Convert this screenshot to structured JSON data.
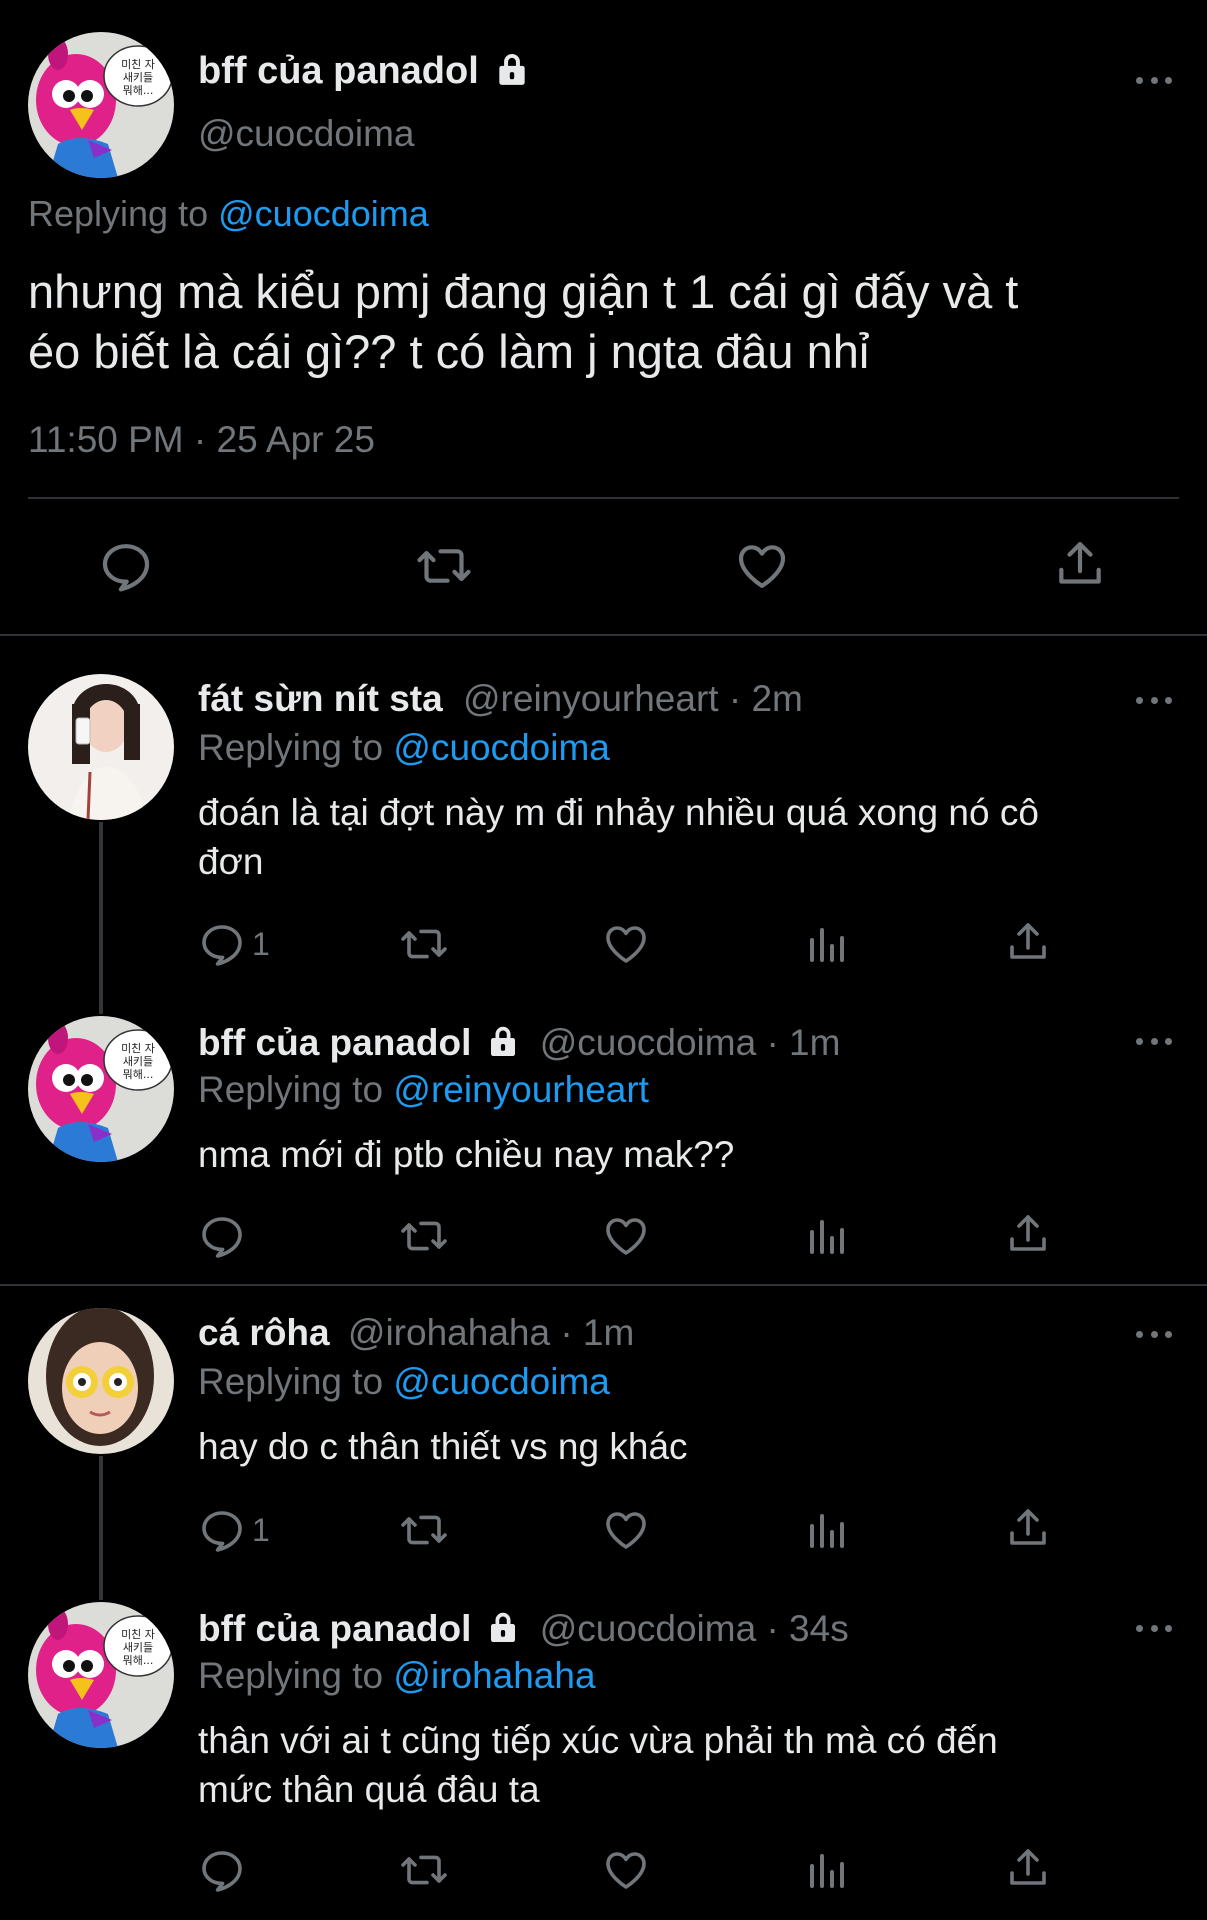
{
  "main_tweet": {
    "author_name": "bff của panadol",
    "author_handle": "@cuocdoima",
    "replying_prefix": "Replying to",
    "replying_to": "@cuocdoima",
    "text_line1": "nhưng mà kiểu pmj đang giận t 1 cái gì đấy và t",
    "text_line2": "éo biết là cái gì?? t có làm j ngta đâu nhỉ",
    "timestamp": "11:50 PM · 25 Apr 25",
    "avatar_speech": "미친 자\n새키들\n뭐해..."
  },
  "replies": [
    {
      "author_name": "fát sừn nít sta",
      "meta": "@reinyourheart · 2m",
      "replying_prefix": "Replying to",
      "replying_to": "@cuocdoima",
      "text_line1": "đoán là tại đợt này m đi nhảy nhiều quá xong nó cô",
      "text_line2": "đơn",
      "reply_count": "1"
    },
    {
      "author_name": "bff của panadol",
      "meta": "@cuocdoima · 1m",
      "replying_prefix": "Replying to",
      "replying_to": "@reinyourheart",
      "text_line1": "nma mới đi ptb chiều nay mak??",
      "text_line2": "",
      "reply_count": ""
    },
    {
      "author_name": "cá rôha",
      "meta": "@irohahaha · 1m",
      "replying_prefix": "Replying to",
      "replying_to": "@cuocdoima",
      "text_line1": "hay do c thân thiết vs ng khác",
      "text_line2": "",
      "reply_count": "1"
    },
    {
      "author_name": "bff của panadol",
      "meta": "@cuocdoima · 34s",
      "replying_prefix": "Replying to",
      "replying_to": "@irohahaha",
      "text_line1": "thân với ai t cũng tiếp xúc vừa phải th mà có đến",
      "text_line2": "mức thân quá đâu ta",
      "reply_count": ""
    }
  ],
  "colors": {
    "background": "#000000",
    "text": "#e7e9ea",
    "secondary": "#71767b",
    "link": "#1d9bf0",
    "divider": "#2f3336"
  },
  "icons": [
    "lock-icon",
    "more-icon",
    "reply-icon",
    "retweet-icon",
    "like-icon",
    "share-icon",
    "analytics-icon"
  ]
}
